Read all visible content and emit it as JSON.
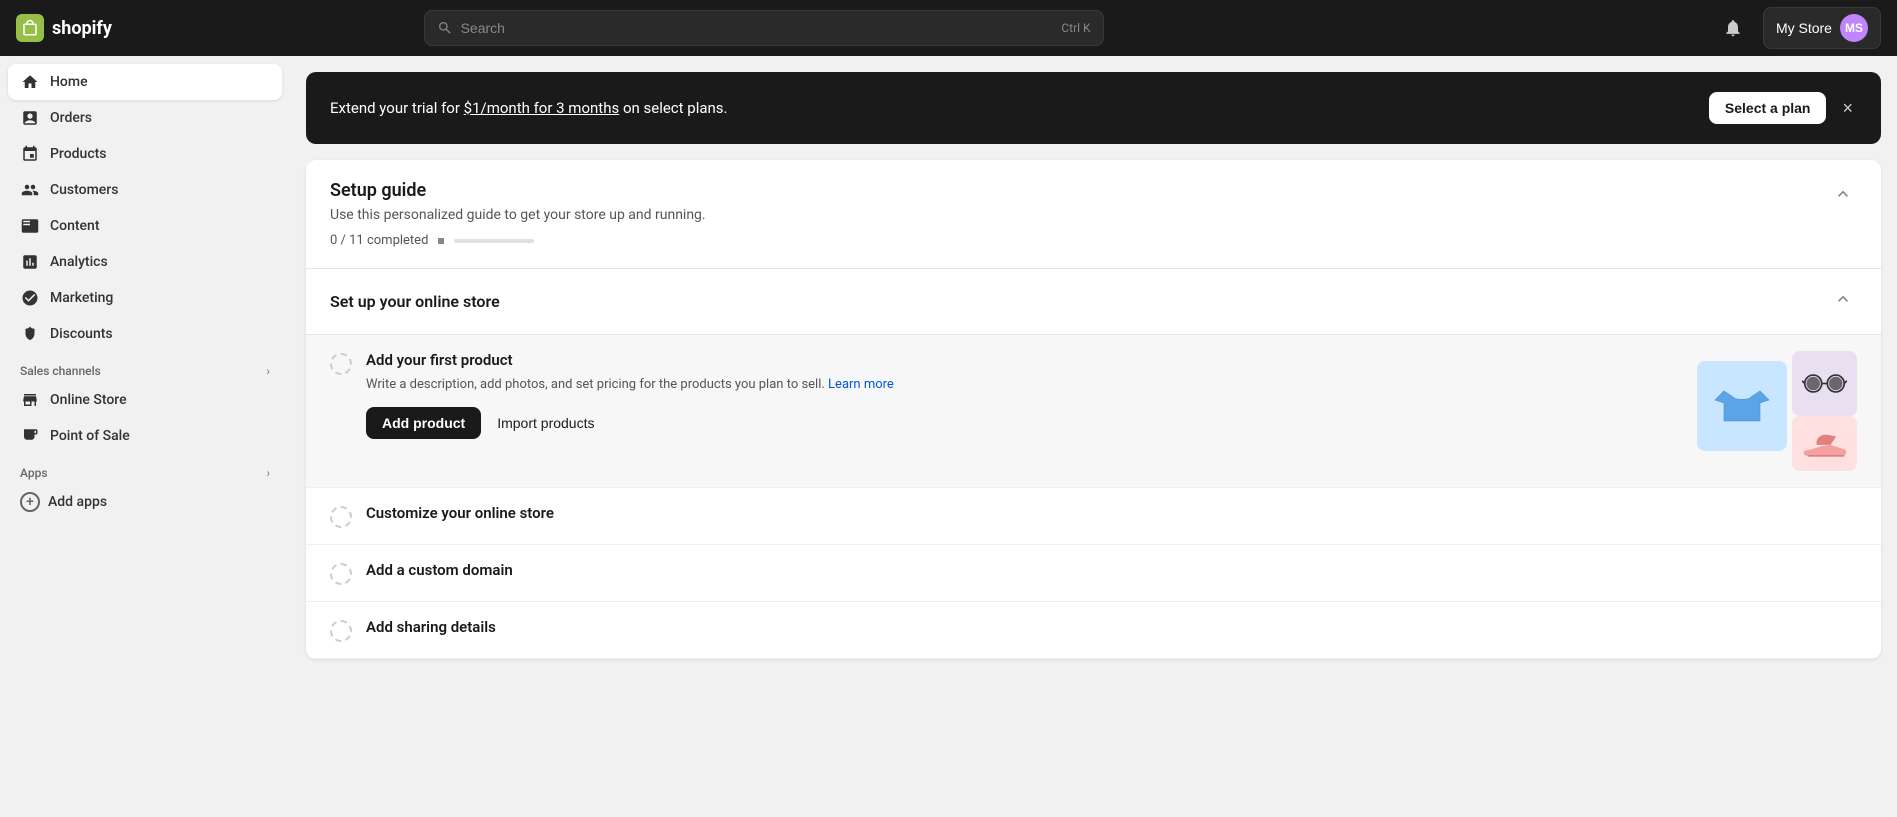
{
  "topnav": {
    "logo_text": "shopify",
    "search_placeholder": "Search",
    "search_shortcut": "Ctrl K",
    "store_name": "My Store",
    "store_avatar": "MS"
  },
  "sidebar": {
    "items": [
      {
        "id": "home",
        "label": "Home",
        "icon": "home"
      },
      {
        "id": "orders",
        "label": "Orders",
        "icon": "orders"
      },
      {
        "id": "products",
        "label": "Products",
        "icon": "products"
      },
      {
        "id": "customers",
        "label": "Customers",
        "icon": "customers"
      },
      {
        "id": "content",
        "label": "Content",
        "icon": "content"
      },
      {
        "id": "analytics",
        "label": "Analytics",
        "icon": "analytics"
      },
      {
        "id": "marketing",
        "label": "Marketing",
        "icon": "marketing"
      },
      {
        "id": "discounts",
        "label": "Discounts",
        "icon": "discounts"
      }
    ],
    "sales_channels_label": "Sales channels",
    "sales_channels_items": [
      {
        "id": "online-store",
        "label": "Online Store",
        "icon": "online-store"
      },
      {
        "id": "point-of-sale",
        "label": "Point of Sale",
        "icon": "point-of-sale"
      }
    ],
    "apps_label": "Apps",
    "add_apps_label": "Add apps"
  },
  "banner": {
    "text": "Extend your trial for $1/month for 3 months on select plans.",
    "select_plan_label": "Select a plan",
    "close_label": "×"
  },
  "setup_guide": {
    "title": "Setup guide",
    "subtitle": "Use this personalized guide to get your store up and running.",
    "progress_text": "0 / 11 completed",
    "progress_percent": 0,
    "collapse_icon": "chevron-up"
  },
  "online_store_section": {
    "title": "Set up your online store",
    "collapse_icon": "chevron-up"
  },
  "tasks": [
    {
      "id": "add-first-product",
      "title": "Add your first product",
      "description": "Write a description, add photos, and set pricing for the products you plan to sell.",
      "link_text": "Learn more",
      "expanded": true,
      "primary_btn": "Add product",
      "secondary_btn": "Import products",
      "has_illustration": true
    },
    {
      "id": "customize-online-store",
      "title": "Customize your online store",
      "description": "",
      "expanded": false,
      "has_illustration": false
    },
    {
      "id": "add-custom-domain",
      "title": "Add a custom domain",
      "description": "",
      "expanded": false,
      "has_illustration": false
    },
    {
      "id": "add-sharing-details",
      "title": "Add sharing details",
      "description": "",
      "expanded": false,
      "has_illustration": false
    }
  ]
}
